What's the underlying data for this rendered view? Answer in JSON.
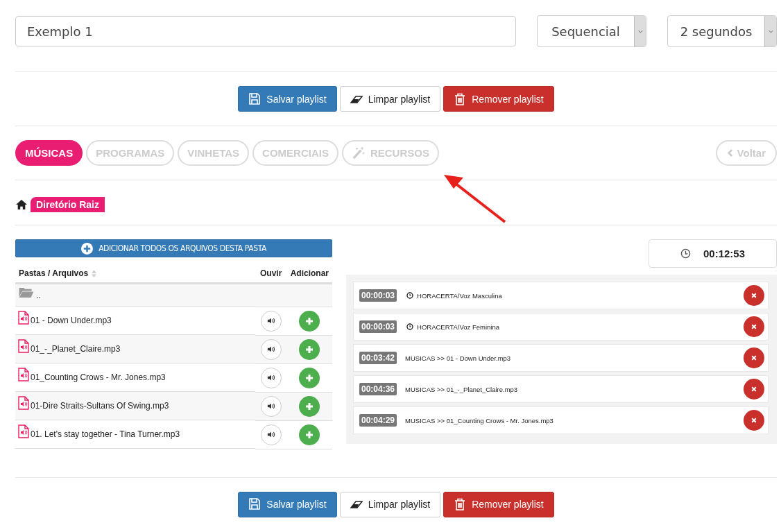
{
  "playlist_name": {
    "value": "Exemplo 1"
  },
  "mode_select": {
    "value": "Sequencial"
  },
  "interval_select": {
    "value": "2 segundos"
  },
  "top_actions": [
    {
      "kind": "save",
      "label": "Salvar playlist"
    },
    {
      "kind": "clear",
      "label": "Limpar playlist"
    },
    {
      "kind": "remove",
      "label": "Remover playlist"
    }
  ],
  "tabs": [
    {
      "label": "MÚSICAS",
      "selected": true,
      "kind": "plain"
    },
    {
      "label": "PROGRAMAS",
      "selected": false,
      "kind": "plain"
    },
    {
      "label": "VINHETAS",
      "selected": false,
      "kind": "plain"
    },
    {
      "label": "COMERCIAIS",
      "selected": false,
      "kind": "plain"
    },
    {
      "label": "RECURSOS",
      "selected": false,
      "kind": "wand"
    }
  ],
  "back_button": {
    "label": "Voltar",
    "disabled": true
  },
  "breadcrumb": {
    "label": "Diretório Raiz"
  },
  "add_all_button": {
    "label": "ADICIONAR TODOS OS ARQUIVOS DESTA PASTA"
  },
  "table": {
    "columns": [
      "Pastas / Arquivos",
      "Ouvir",
      "Adicionar"
    ],
    "rows": [
      {
        "kind": "folder",
        "name": ".."
      },
      {
        "kind": "file",
        "name": "01 - Down Under.mp3"
      },
      {
        "kind": "file",
        "name": "01_-_Planet_Claire.mp3"
      },
      {
        "kind": "file",
        "name": "01_Counting Crows - Mr. Jones.mp3"
      },
      {
        "kind": "file",
        "name": "01-Dire Straits-Sultans Of Swing.mp3"
      },
      {
        "kind": "file",
        "name": "01. Let's stay together - Tina Turner.mp3"
      }
    ]
  },
  "total_duration": "00:12:53",
  "playlist": [
    {
      "kind": "time",
      "duration": "00:00:03",
      "title": "HORACERTA/Voz Masculina"
    },
    {
      "kind": "time",
      "duration": "00:00:03",
      "title": "HORACERTA/Voz Feminina"
    },
    {
      "kind": "music",
      "duration": "00:03:42",
      "title": "MUSICAS >> 01 - Down Under.mp3"
    },
    {
      "kind": "music",
      "duration": "00:04:36",
      "title": "MUSICAS >> 01_-_Planet_Claire.mp3"
    },
    {
      "kind": "music",
      "duration": "00:04:29",
      "title": "MUSICAS >> 01_Counting Crows - Mr. Jones.mp3"
    }
  ],
  "bottom_actions": [
    {
      "kind": "save",
      "label": "Salvar playlist"
    },
    {
      "kind": "clear",
      "label": "Limpar playlist"
    },
    {
      "kind": "remove",
      "label": "Remover playlist"
    }
  ]
}
